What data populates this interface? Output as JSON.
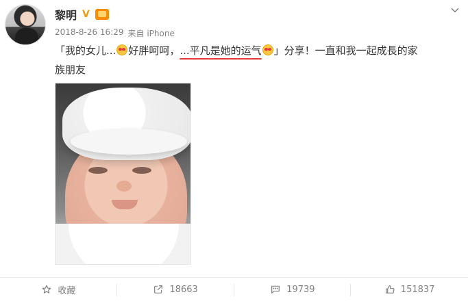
{
  "post": {
    "author": {
      "name": "黎明",
      "badge_text": "V"
    },
    "meta": {
      "datetime": "2018-8-26 16:29",
      "source_label": "来自 iPhone"
    },
    "content": {
      "line1_before": "「我的女儿...",
      "line1_after_emoji": "好胖呵呵，",
      "line1_highlight": "...平凡是她的运气",
      "line1_after_highlight": "」分享！一直和我一起成長的家",
      "line2": "族朋友"
    }
  },
  "actions": {
    "favorite_label": "收藏",
    "share_count": "18663",
    "comment_count": "19739",
    "like_count": "151837"
  },
  "icons": {
    "chevron": "chevron-down-icon",
    "favorite": "star-icon",
    "share": "share-icon",
    "comment": "comment-icon",
    "like": "thumb-up-icon",
    "emoji": "heart-eyes-emoji-icon",
    "vip": "vip-crown-icon"
  },
  "colors": {
    "accent_underline": "#e53935",
    "badge_v": "#f39c12",
    "muted_text": "#808080"
  }
}
